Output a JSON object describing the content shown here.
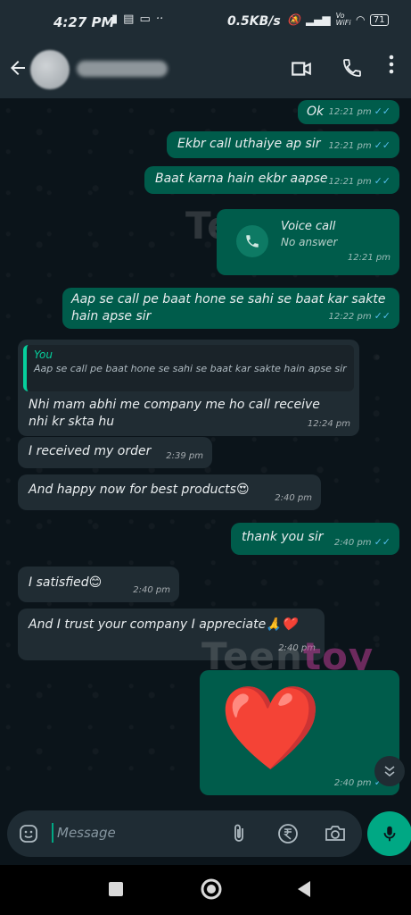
{
  "status_bar": {
    "time": "4:27 PM",
    "net_speed": "0.5KB/s",
    "battery": "71"
  },
  "header": {
    "contact_name": ""
  },
  "messages": [
    {
      "dir": "out",
      "text": "Ok",
      "time": "12:21 pm"
    },
    {
      "dir": "out",
      "text": "Ekbr call uthaiye ap sir",
      "time": "12:21 pm"
    },
    {
      "dir": "out",
      "text": "Baat karna hain ekbr aapse",
      "time": "12:21 pm"
    },
    {
      "dir": "out",
      "title": "Voice call",
      "subtitle": "No answer",
      "time": "12:21 pm"
    },
    {
      "dir": "out",
      "text": "Aap se call pe baat hone se sahi se baat kar sakte hain apse sir",
      "time": "12:22 pm"
    },
    {
      "dir": "in",
      "quote_author": "You",
      "quote_text": "Aap se call pe baat hone se sahi se baat kar sakte hain apse sir",
      "text": "Nhi mam abhi me company me ho call receive nhi kr skta hu",
      "time": "12:24 pm"
    },
    {
      "dir": "in",
      "text": "I received my order",
      "time": "2:39 pm"
    },
    {
      "dir": "in",
      "text": "And happy now for best products😍",
      "time": "2:40 pm"
    },
    {
      "dir": "out",
      "text": "thank you sir",
      "time": "2:40 pm"
    },
    {
      "dir": "in",
      "text": "I satisfied😊",
      "time": "2:40 pm"
    },
    {
      "dir": "in",
      "text": "And I trust your company I appreciate🙏❤️",
      "time": "2:40 pm"
    },
    {
      "dir": "out",
      "sticker": "❤️",
      "time": "2:40 pm"
    }
  ],
  "watermark": {
    "part1": "Teen",
    "part2": "toy"
  },
  "input": {
    "placeholder": "Message"
  },
  "colors": {
    "outgoing": "#005c4b",
    "incoming": "#202c33",
    "accent": "#00a884",
    "read_tick": "#53bdeb",
    "background": "#0b141a"
  },
  "icons": [
    "back-arrow-icon",
    "video-call-icon",
    "phone-icon",
    "more-vert-icon",
    "emoji-icon",
    "attach-icon",
    "rupee-icon",
    "camera-icon",
    "mic-icon",
    "scroll-down-icon",
    "nav-recents-icon",
    "nav-home-icon",
    "nav-back-icon"
  ]
}
